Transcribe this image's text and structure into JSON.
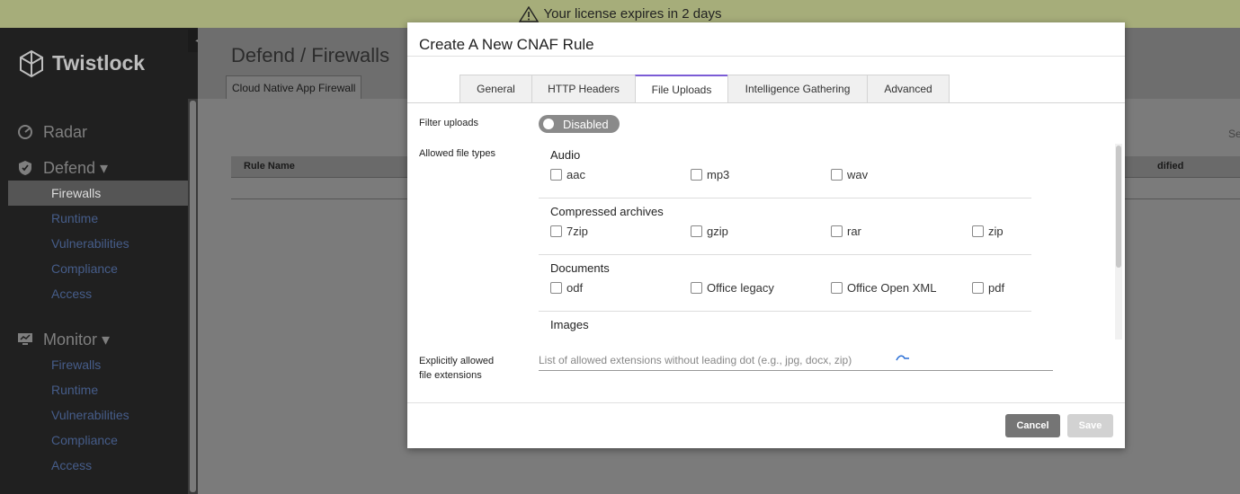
{
  "banner": {
    "text": "Your license expires in 2 days"
  },
  "sidebar": {
    "brand": "Twistlock",
    "collapse_glyph": "◀",
    "groups": [
      {
        "label": "Radar",
        "icon": "radar-icon"
      },
      {
        "label": "Defend ▾",
        "icon": "shield-icon",
        "items": [
          "Firewalls",
          "Runtime",
          "Vulnerabilities",
          "Compliance",
          "Access"
        ],
        "active": "Firewalls"
      },
      {
        "label": "Monitor ▾",
        "icon": "monitor-icon",
        "items": [
          "Firewalls",
          "Runtime",
          "Vulnerabilities",
          "Compliance",
          "Access"
        ]
      }
    ]
  },
  "main": {
    "title": "Defend / Firewalls",
    "tab": "Cloud Native App Firewall",
    "table": {
      "col_rule": "Rule Name",
      "col_modified": "dified"
    },
    "search_stub": "Se"
  },
  "modal": {
    "title": "Create A New CNAF Rule",
    "tabs": [
      "General",
      "HTTP Headers",
      "File Uploads",
      "Intelligence Gathering",
      "Advanced"
    ],
    "active_tab": "File Uploads",
    "filter_label": "Filter uploads",
    "filter_state": "Disabled",
    "types_label": "Allowed file types",
    "groups": [
      {
        "title": "Audio",
        "items": [
          "aac",
          "mp3",
          "wav"
        ]
      },
      {
        "title": "Compressed archives",
        "items": [
          "7zip",
          "gzip",
          "rar",
          "zip"
        ]
      },
      {
        "title": "Documents",
        "items": [
          "odf",
          "Office legacy",
          "Office Open XML",
          "pdf"
        ]
      },
      {
        "title": "Images",
        "items": []
      }
    ],
    "ext_label_line1": "Explicitly allowed",
    "ext_label_line2": "file extensions",
    "ext_placeholder": "List of allowed extensions without leading dot (e.g., jpg, docx, zip)",
    "cancel": "Cancel",
    "save": "Save"
  },
  "colors": {
    "accent_tab": "#7b5cd6",
    "sidebar_link": "#465d8a",
    "banner": "#a6ad7a"
  }
}
